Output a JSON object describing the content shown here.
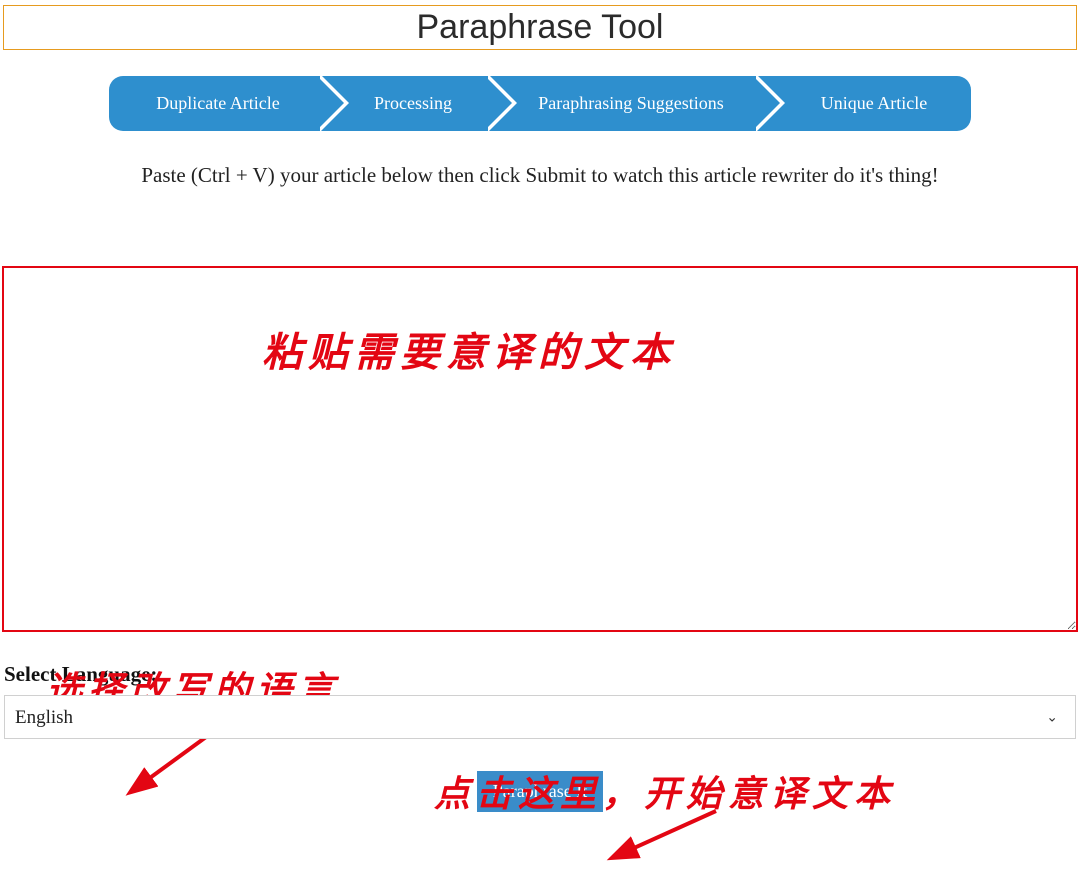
{
  "title": "Paraphrase Tool",
  "steps": {
    "s1": "Duplicate Article",
    "s2": "Processing",
    "s3": "Paraphrasing Suggestions",
    "s4": "Unique Article"
  },
  "instruction": "Paste (Ctrl + V) your article below then click Submit to watch this article rewriter do it's thing!",
  "textarea": {
    "value": "",
    "placeholder": ""
  },
  "annotations": {
    "paste_text": "粘贴需要意译的文本",
    "select_lang": "选择改写的语言",
    "click_here": "点击这里，开始意译文本"
  },
  "language": {
    "label": "Select Language:",
    "selected": "English"
  },
  "submit": {
    "label": "Paraphrase It"
  },
  "colors": {
    "accent_blue": "#2e8fce",
    "title_border": "#e69b1f",
    "annotation_red": "#e30613"
  }
}
